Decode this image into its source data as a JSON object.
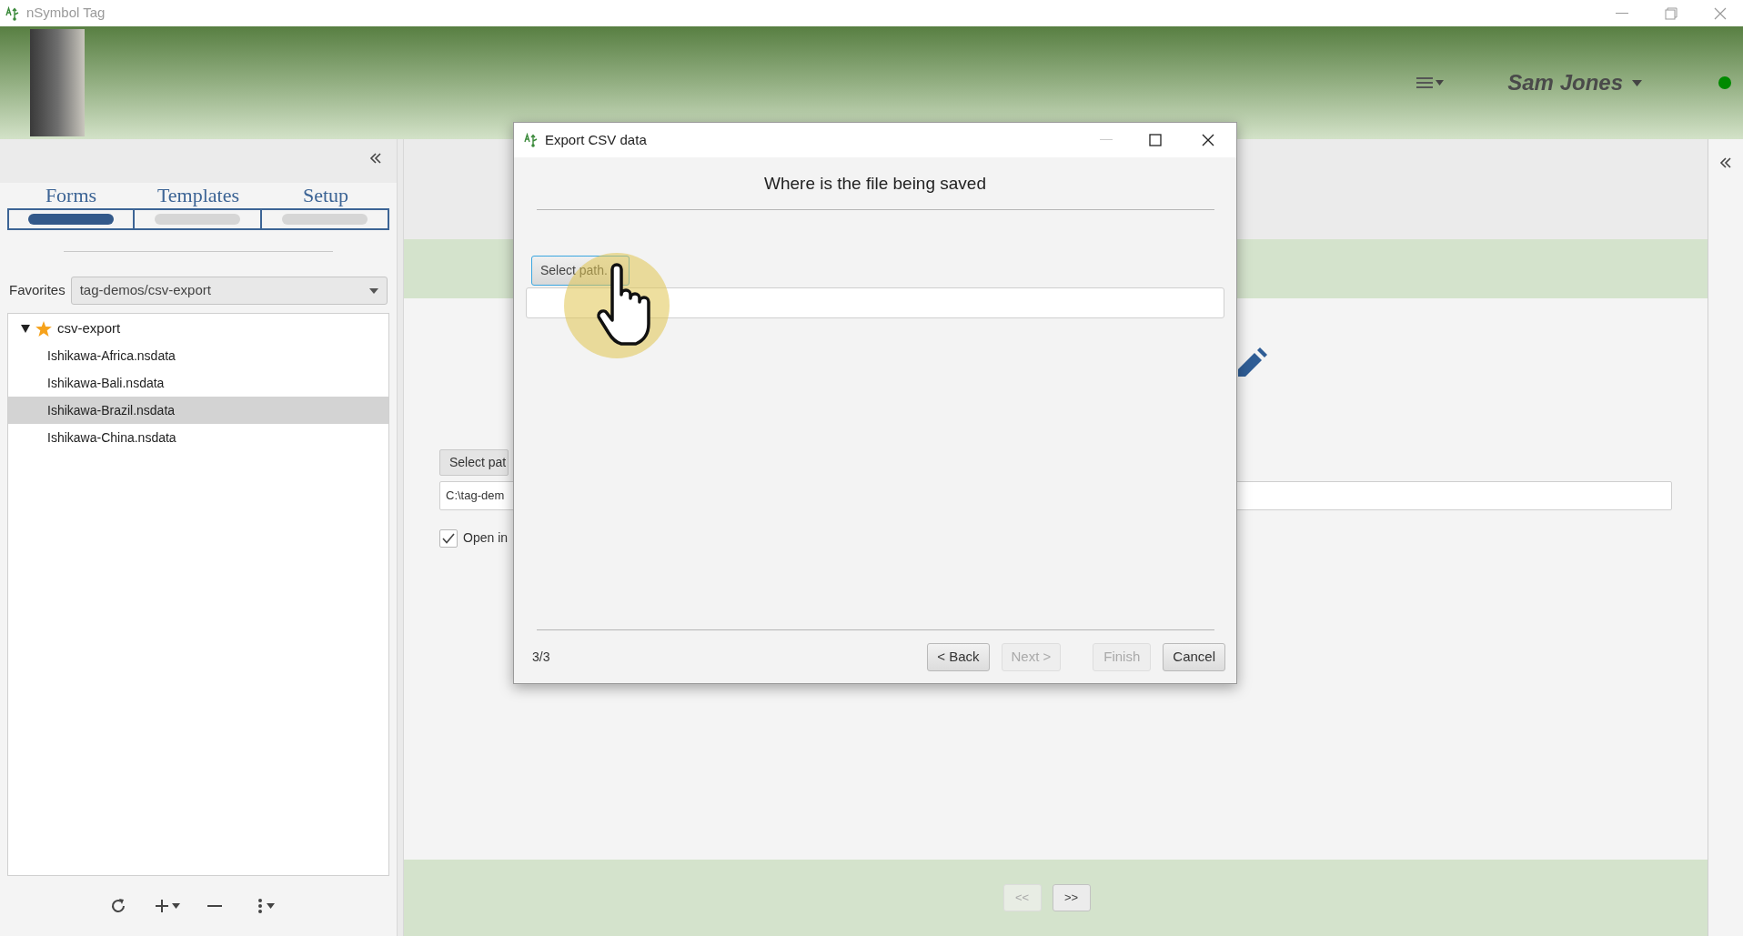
{
  "app_window": {
    "title": "nSymbol Tag"
  },
  "header": {
    "user_name": "Sam Jones"
  },
  "sidebar": {
    "tabs": [
      {
        "label": "Forms",
        "selected": true
      },
      {
        "label": "Templates",
        "selected": false
      },
      {
        "label": "Setup",
        "selected": false
      }
    ],
    "favorites_label": "Favorites",
    "favorites_value": "tag-demos/csv-export",
    "tree": [
      {
        "label": "csv-export",
        "expanded": true,
        "favorite": true,
        "selected": false,
        "children": [
          {
            "label": "Ishikawa-Africa.nsdata",
            "selected": false
          },
          {
            "label": "Ishikawa-Bali.nsdata",
            "selected": false
          },
          {
            "label": "Ishikawa-Brazil.nsdata",
            "selected": true
          },
          {
            "label": "Ishikawa-China.nsdata",
            "selected": false
          }
        ]
      }
    ]
  },
  "main": {
    "select_path_button": "Select pat",
    "path_field_value": "C:\\tag-dem",
    "open_checkbox": {
      "label": "Open in",
      "checked": true
    },
    "nav_buttons": [
      {
        "label": "<<",
        "disabled": true
      },
      {
        "label": ">>",
        "disabled": false
      }
    ]
  },
  "dialog": {
    "title": "Export CSV data",
    "heading": "Where is the file being saved",
    "select_path_button": "Select path.",
    "step": "3/3",
    "buttons": [
      {
        "label": "< Back",
        "disabled": false
      },
      {
        "label": "Next >",
        "disabled": true
      },
      {
        "label": "Finish",
        "disabled": true
      },
      {
        "label": "Cancel",
        "disabled": false
      }
    ]
  }
}
